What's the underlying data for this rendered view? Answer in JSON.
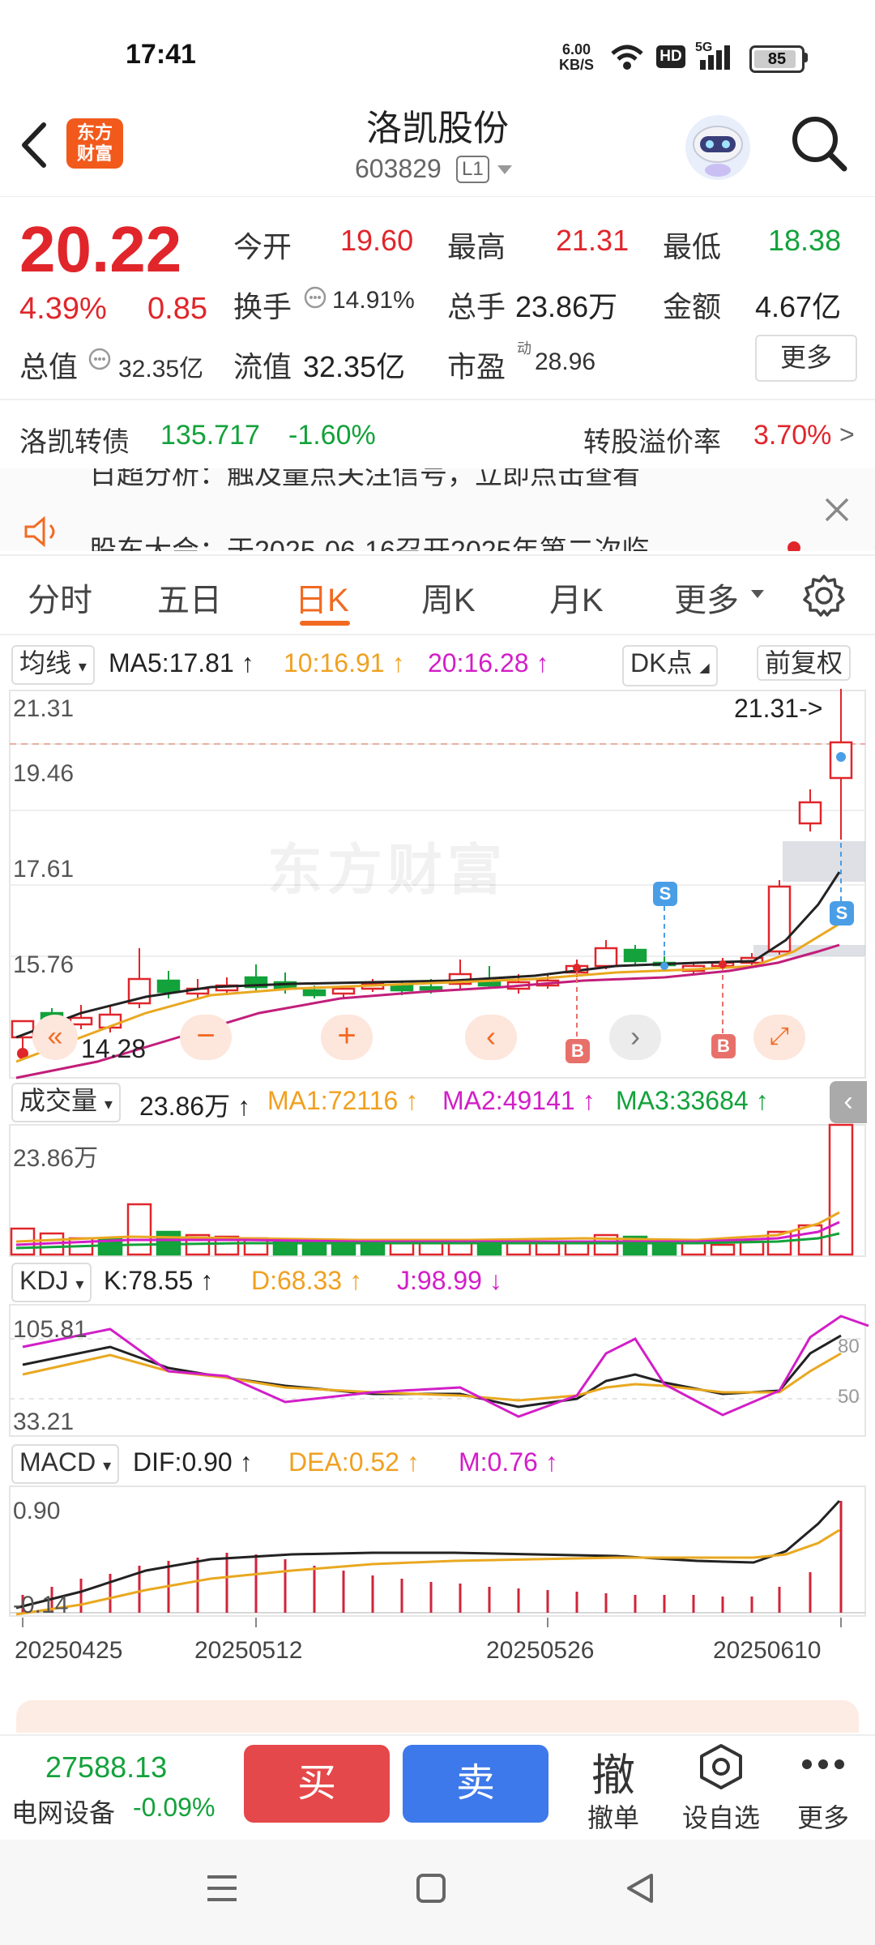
{
  "status": {
    "time": "17:41",
    "speed_value": "6.00",
    "speed_unit": "KB/S",
    "hd": "HD",
    "network": "5G",
    "battery": "85"
  },
  "header": {
    "title": "洛凯股份",
    "code": "603829",
    "level": "L1",
    "logo_line1": "东方",
    "logo_line2": "财富"
  },
  "quote": {
    "price": "20.22",
    "change_pct": "4.39%",
    "change_amt": "0.85",
    "open_label": "今开",
    "open": "19.60",
    "high_label": "最高",
    "high": "21.31",
    "low_label": "最低",
    "low": "18.38",
    "turnover_label": "换手",
    "turnover": "14.91%",
    "volume_label": "总手",
    "volume": "23.86万",
    "amount_label": "金额",
    "amount": "4.67亿",
    "mktcap_label": "总值",
    "mktcap": "32.35亿",
    "float_label": "流值",
    "float": "32.35亿",
    "pe_label": "市盈",
    "pe_sup": "动",
    "pe": "28.96",
    "more": "更多"
  },
  "bond": {
    "name": "洛凯转债",
    "price": "135.717",
    "change": "-1.60%",
    "premium_label": "转股溢价率",
    "premium": "3.70%",
    "arrow": ">"
  },
  "news": {
    "item1": "日超分析：触及量点关注信号，立即点击查看",
    "item2": "股东大会：于2025-06-16召开2025年第二次临"
  },
  "tabs": [
    "分时",
    "五日",
    "日K",
    "周K",
    "月K",
    "更多"
  ],
  "kline": {
    "ma_selector": "均线",
    "ma5": "MA5:17.81 ↑",
    "ma10": "10:16.91 ↑",
    "ma20": "20:16.28 ↑",
    "dk_button": "DK点",
    "adjust_button": "前复权",
    "axis": [
      "21.31",
      "19.46",
      "17.61",
      "15.76"
    ],
    "high_marker": "21.31->",
    "low_marker": "14.28",
    "watermark": "东方财富",
    "buy_signal": "B",
    "sell_signal": "S"
  },
  "volume": {
    "selector": "成交量",
    "value": "23.86万 ↑",
    "ma1": "MA1:72116 ↑",
    "ma2": "MA2:49141 ↑",
    "ma3": "MA3:33684 ↑",
    "axis_top": "23.86万"
  },
  "kdj": {
    "selector": "KDJ",
    "k": "K:78.55 ↑",
    "d": "D:68.33 ↑",
    "j": "J:98.99 ↓",
    "axis_top": "105.81",
    "axis_bottom": "33.21",
    "level80": "80",
    "level50": "50"
  },
  "macd": {
    "selector": "MACD",
    "dif": "DIF:0.90 ↑",
    "dea": "DEA:0.52 ↑",
    "m": "M:0.76 ↑",
    "axis_top": "0.90",
    "axis_bottom": "-0.14"
  },
  "dates": [
    "20250425",
    "20250512",
    "20250526",
    "20250610"
  ],
  "bottom": {
    "index_value": "27588.13",
    "index_name": "电网设备",
    "index_change": "-0.09%",
    "buy": "买",
    "sell": "卖",
    "cancel_icon": "撤",
    "cancel": "撤单",
    "watch": "设自选",
    "more": "更多"
  },
  "colors": {
    "up": "#e0262b",
    "down": "#13a23b",
    "accent": "#f26a22",
    "buy": "#e5484a",
    "sell": "#3d79ea"
  }
}
